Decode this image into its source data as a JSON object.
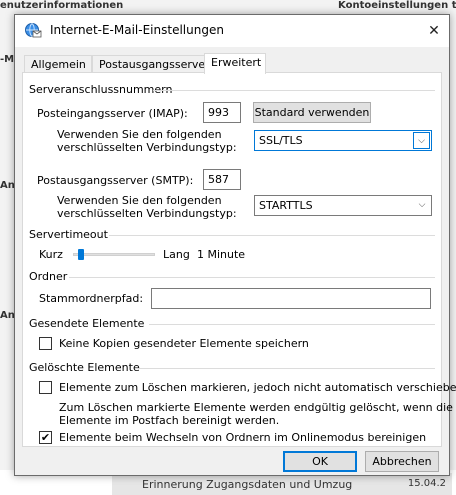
{
  "background": {
    "left_header": "enutzerinformationen",
    "right_header": "Kontoeinstellungen te",
    "left_fragments": [
      "",
      "-M",
      "",
      "",
      "",
      "",
      "Ann",
      "",
      "",
      "Ann",
      "",
      "",
      ""
    ],
    "status_text": "Erinnerung Zugangsdaten und Umzug",
    "status_date": "15.04.2"
  },
  "dialog": {
    "title": "Internet-E-Mail-Einstellungen",
    "close_glyph": "✕"
  },
  "tabs": [
    {
      "label": "Allgemein"
    },
    {
      "label": "Postausgangsserver"
    },
    {
      "label": "Erweitert"
    }
  ],
  "server_ports": {
    "section_title": "Serveranschlussnummern",
    "imap_label": "Posteingangsserver (IMAP):",
    "imap_port": "993",
    "default_button": "Standard verwenden",
    "imap_encryption_label_1": "Verwenden Sie den folgenden",
    "imap_encryption_label_2": "verschlüsselten Verbindungstyp:",
    "imap_encryption_value": "SSL/TLS",
    "smtp_label": "Postausgangsserver (SMTP):",
    "smtp_port": "587",
    "smtp_encryption_label_1": "Verwenden Sie den folgenden",
    "smtp_encryption_label_2": "verschlüsselten Verbindungstyp:",
    "smtp_encryption_value": "STARTTLS"
  },
  "timeout": {
    "section_title": "Servertimeout",
    "short_label": "Kurz",
    "long_label": "Lang",
    "value_text": "1 Minute",
    "slider_level": 0.1
  },
  "folders": {
    "section_title": "Ordner",
    "root_path_label": "Stammordnerpfad:",
    "root_path_value": ""
  },
  "sent_items": {
    "section_title": "Gesendete Elemente",
    "no_copies_label": "Keine Kopien gesendeter Elemente speichern",
    "no_copies_checked": false
  },
  "deleted_items": {
    "section_title": "Gelöschte Elemente",
    "mark_label": "Elemente zum Löschen markieren, jedoch nicht automatisch verschieben",
    "mark_checked": false,
    "note_1": "Zum Löschen markierte Elemente werden endgültig gelöscht, wenn die",
    "note_2": "Elemente im Postfach bereinigt werden.",
    "purge_label": "Elemente beim Wechseln von Ordnern im Onlinemodus bereinigen",
    "purge_checked": true
  },
  "footer": {
    "ok_label": "OK",
    "cancel_label": "Abbrechen"
  },
  "icons": {
    "title_icon": "globe-mail-icon",
    "dropdown_arrow": "⌵",
    "check_glyph": "✔"
  },
  "colors": {
    "accent": "#0078d7",
    "dialog_bg": "#f0f0f0",
    "panel_bg": "#ffffff"
  }
}
